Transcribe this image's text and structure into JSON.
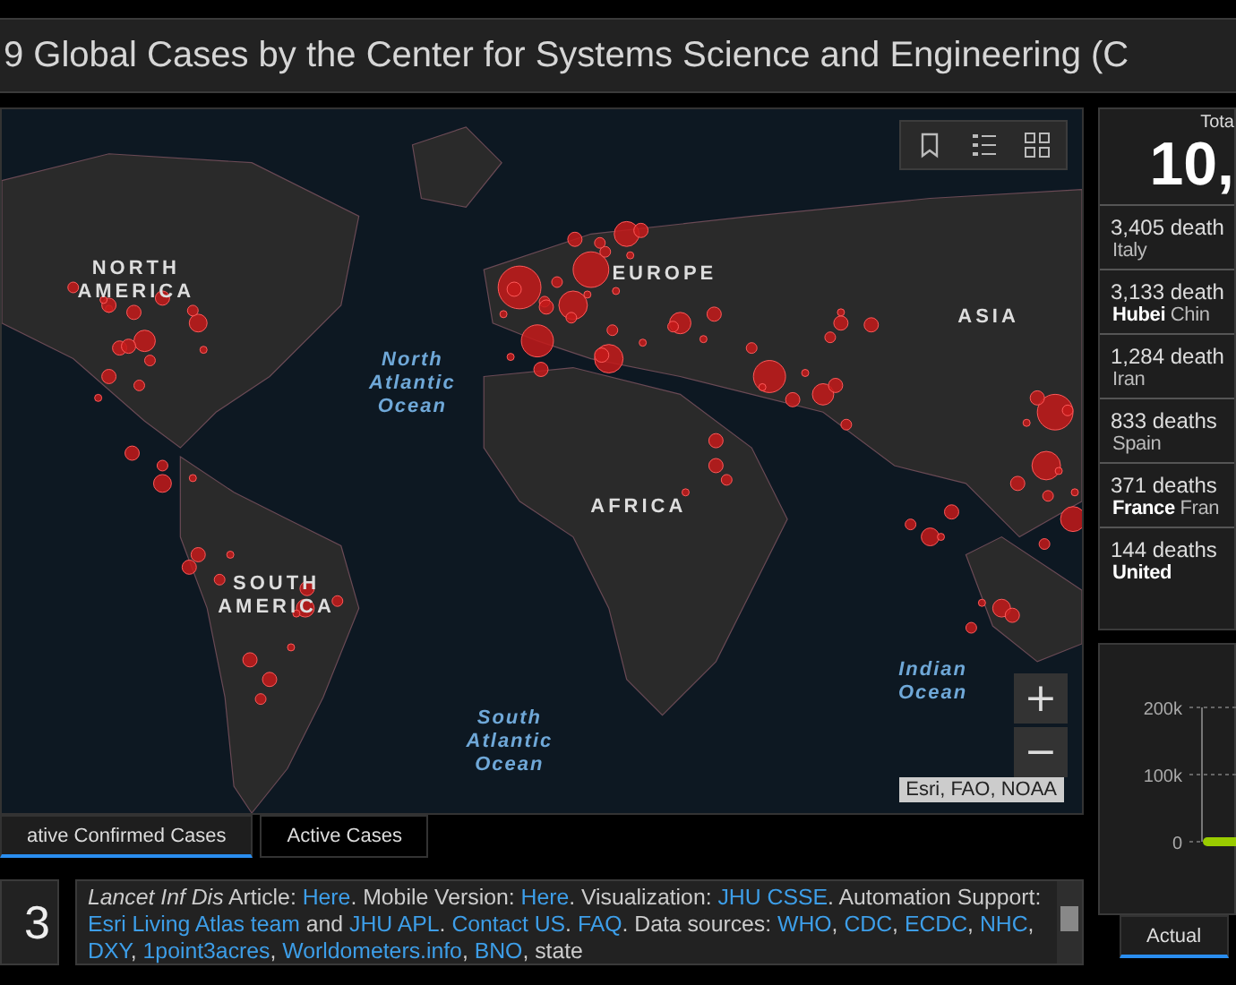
{
  "header": {
    "title": "9 Global Cases by the Center for Systems Science and Engineering (C"
  },
  "map": {
    "labels": [
      {
        "text": "NORTH\nAMERICA",
        "kind": "region"
      },
      {
        "text": "EUROPE",
        "kind": "region"
      },
      {
        "text": "ASIA",
        "kind": "region"
      },
      {
        "text": "AFRICA",
        "kind": "region"
      },
      {
        "text": "SOUTH\nAMERICA",
        "kind": "region"
      },
      {
        "text": "North\nAtlantic\nOcean",
        "kind": "ocean"
      },
      {
        "text": "South\nAtlantic\nOcean",
        "kind": "ocean"
      },
      {
        "text": "Indian\nOcean",
        "kind": "ocean"
      }
    ],
    "zoom": [
      "+",
      "−"
    ],
    "attribution": "Esri, FAO, NOAA"
  },
  "map_tabs": [
    {
      "label": "ative Confirmed Cases",
      "selected": true
    },
    {
      "label": "Active Cases",
      "selected": false
    }
  ],
  "count_box": {
    "value": "3"
  },
  "info": {
    "segments": [
      {
        "text": "Lancet Inf Dis",
        "kind": "italic"
      },
      {
        "text": " Article: ",
        "kind": "plain"
      },
      {
        "text": "Here",
        "kind": "link"
      },
      {
        "text": ". Mobile Version: ",
        "kind": "plain"
      },
      {
        "text": "Here",
        "kind": "link"
      },
      {
        "text": ". Visualization: ",
        "kind": "plain"
      },
      {
        "text": "JHU CSSE",
        "kind": "link"
      },
      {
        "text": ". Automation Support: ",
        "kind": "plain"
      },
      {
        "text": "Esri Living Atlas team",
        "kind": "link"
      },
      {
        "text": " and ",
        "kind": "plain"
      },
      {
        "text": "JHU APL",
        "kind": "link"
      },
      {
        "text": ". ",
        "kind": "plain"
      },
      {
        "text": "Contact US",
        "kind": "link"
      },
      {
        "text": ". ",
        "kind": "plain"
      },
      {
        "text": "FAQ",
        "kind": "link"
      },
      {
        "text": ". Data sources: ",
        "kind": "plain"
      },
      {
        "text": "WHO",
        "kind": "link"
      },
      {
        "text": ", ",
        "kind": "plain"
      },
      {
        "text": "CDC",
        "kind": "link"
      },
      {
        "text": ", ",
        "kind": "plain"
      },
      {
        "text": "ECDC",
        "kind": "link"
      },
      {
        "text": ", ",
        "kind": "plain"
      },
      {
        "text": "NHC",
        "kind": "link"
      },
      {
        "text": ", ",
        "kind": "plain"
      },
      {
        "text": "DXY",
        "kind": "link"
      },
      {
        "text": ", ",
        "kind": "plain"
      },
      {
        "text": "1point3acres",
        "kind": "link"
      },
      {
        "text": ", ",
        "kind": "plain"
      },
      {
        "text": "Worldometers.info",
        "kind": "link"
      },
      {
        "text": ", ",
        "kind": "plain"
      },
      {
        "text": "BNO",
        "kind": "link"
      },
      {
        "text": ", state",
        "kind": "plain"
      }
    ]
  },
  "deaths": {
    "label": "Tota",
    "total": "10,",
    "items": [
      {
        "count": "3,405",
        "unit": "death",
        "place": "Italy"
      },
      {
        "count": "3,133",
        "unit": "death",
        "place": "**Hubei** Chin"
      },
      {
        "count": "1,284",
        "unit": "death",
        "place": "Iran"
      },
      {
        "count": "833",
        "unit": "deaths",
        "place": "Spain"
      },
      {
        "count": "371",
        "unit": "deaths",
        "place": "**France** Fran"
      },
      {
        "count": "144",
        "unit": "deaths",
        "place": "**United**"
      }
    ]
  },
  "chart": {
    "ticks": [
      "200k",
      "100k",
      "0"
    ]
  },
  "chart_tabs": [
    {
      "label": "Actual",
      "selected": true
    }
  ]
}
